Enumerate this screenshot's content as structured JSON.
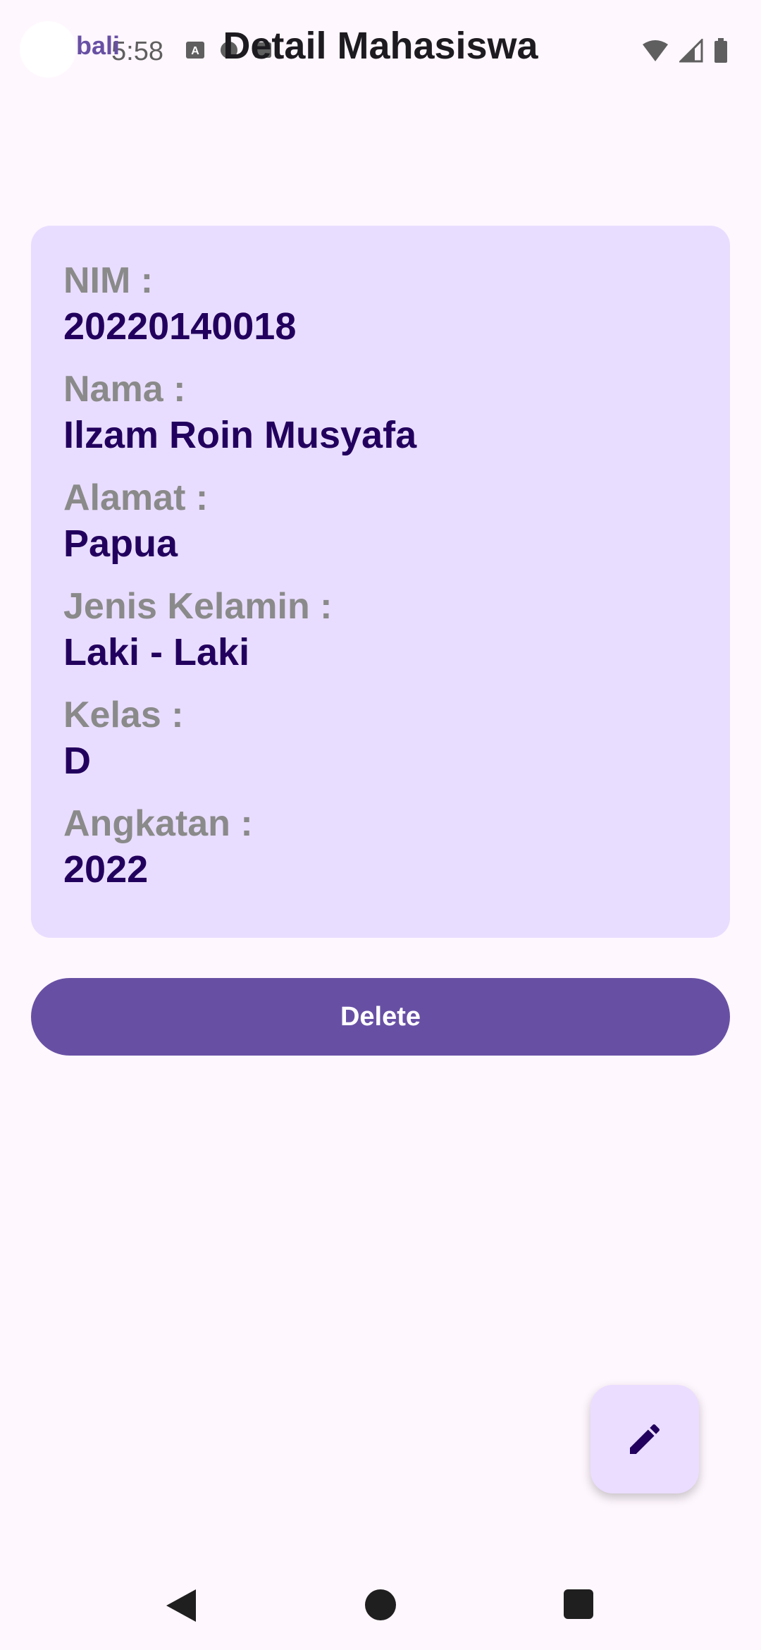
{
  "status_bar": {
    "time": "5:58"
  },
  "app_bar": {
    "back_label": "bali",
    "title": "Detail Mahasiswa"
  },
  "card": {
    "fields": [
      {
        "label": "NIM :",
        "value": "20220140018"
      },
      {
        "label": "Nama :",
        "value": "Ilzam Roin Musyafa"
      },
      {
        "label": "Alamat :",
        "value": "Papua"
      },
      {
        "label": "Jenis Kelamin :",
        "value": "Laki - Laki"
      },
      {
        "label": "Kelas :",
        "value": "D"
      },
      {
        "label": "Angkatan :",
        "value": "2022"
      }
    ]
  },
  "actions": {
    "delete_label": "Delete"
  },
  "icons": {
    "fab": "edit-icon",
    "nav_back": "back-triangle-icon",
    "nav_home": "home-circle-icon",
    "nav_recent": "recents-square-icon"
  },
  "colors": {
    "background": "#FFF7FE",
    "card": "#E9DDFF",
    "primary": "#6750A4",
    "value_text": "#22005D",
    "label_text": "#8a8a8a",
    "fab": "#EADDFF"
  }
}
